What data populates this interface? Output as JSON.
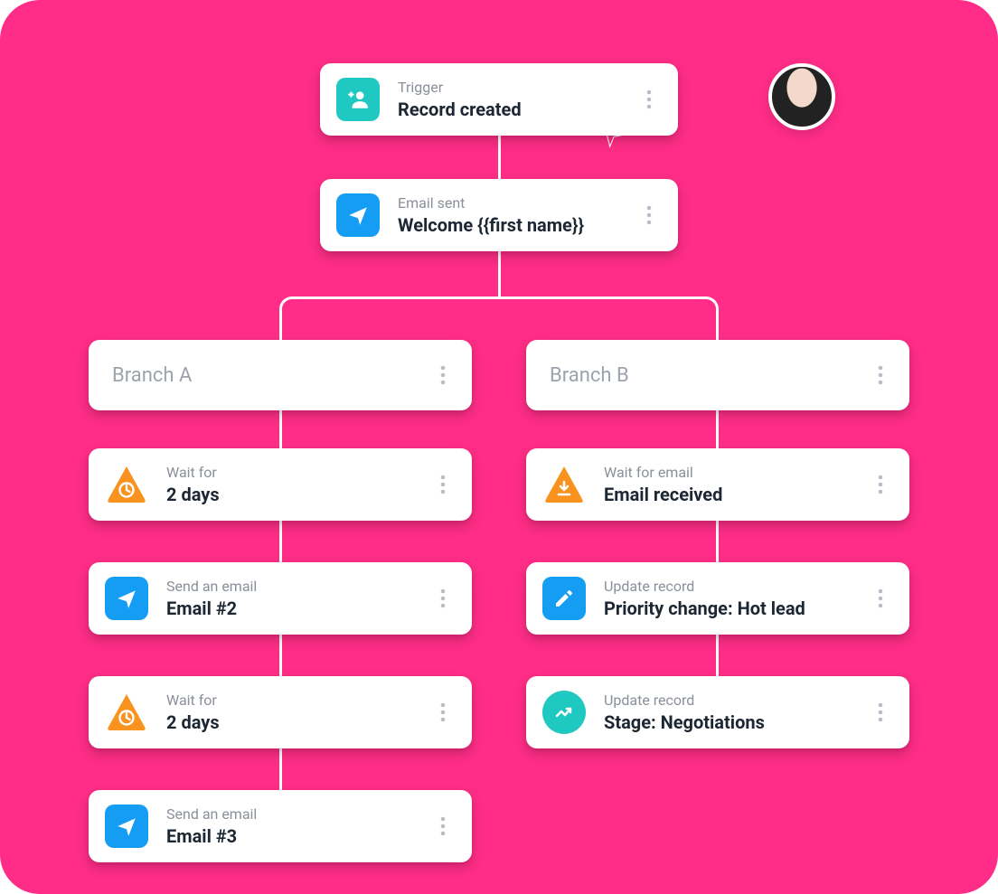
{
  "avatar": {
    "present": true
  },
  "trigger": {
    "sub": "Trigger",
    "main": "Record created",
    "icon": "add-person-icon",
    "icon_color": "#1fc9c1"
  },
  "email_sent": {
    "sub": "Email sent",
    "main": "Welcome {{first name}}",
    "icon": "send-icon",
    "icon_color": "#159df4"
  },
  "branch_a": {
    "label": "Branch A"
  },
  "branch_b": {
    "label": "Branch B"
  },
  "a_steps": [
    {
      "sub": "Wait for",
      "main": "2 days",
      "icon": "wait-clock-icon",
      "shape": "triangle",
      "icon_color": "#f7931e"
    },
    {
      "sub": "Send an email",
      "main": "Email #2",
      "icon": "send-icon",
      "icon_color": "#159df4"
    },
    {
      "sub": "Wait for",
      "main": "2 days",
      "icon": "wait-clock-icon",
      "shape": "triangle",
      "icon_color": "#f7931e"
    },
    {
      "sub": "Send an email",
      "main": "Email #3",
      "icon": "send-icon",
      "icon_color": "#159df4"
    }
  ],
  "b_steps": [
    {
      "sub": "Wait for email",
      "main": "Email received",
      "icon": "wait-download-icon",
      "shape": "triangle",
      "icon_color": "#f7931e"
    },
    {
      "sub": "Update record",
      "main": "Priority change: Hot lead",
      "icon": "edit-icon",
      "icon_color": "#159df4"
    },
    {
      "sub": "Update record",
      "main": "Stage: Negotiations",
      "icon": "trend-icon",
      "icon_color": "#1fc9c1",
      "round": true
    }
  ]
}
